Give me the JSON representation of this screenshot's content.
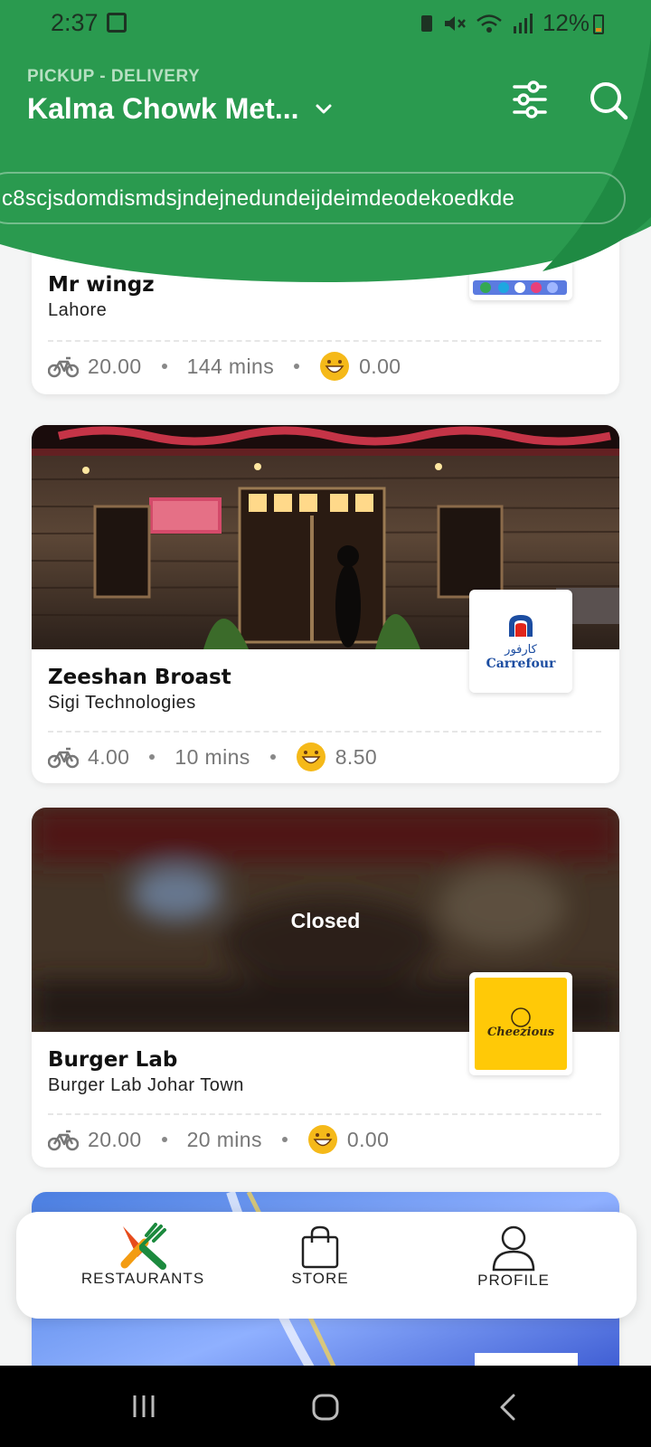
{
  "status_bar": {
    "time": "2:37",
    "battery": "12%"
  },
  "header": {
    "mode_label": "PICKUP - DELIVERY",
    "location": "Kalma Chowk Met...",
    "banner_text": "c8scjsdomdismdsjndejnedundeijdeimdeodekoedkde",
    "colors": {
      "brand_green": "#2a9a4f",
      "wave_dark": "#1f8a43"
    }
  },
  "restaurants": [
    {
      "name": "Mr wingz",
      "branch": "Lahore",
      "delivery_fee": "20.00",
      "time": "144 mins",
      "rating": "0.00",
      "closed": false
    },
    {
      "name": "Zeeshan Broast",
      "branch": "Sigi Technologies",
      "delivery_fee": "4.00",
      "time": "10 mins",
      "rating": "8.50",
      "logo_text": "Carrefour",
      "logo_arabic": "كارفور",
      "closed": false
    },
    {
      "name": "Burger Lab",
      "branch": "Burger Lab Johar Town",
      "delivery_fee": "20.00",
      "time": "20 mins",
      "rating": "0.00",
      "status_label": "Closed",
      "logo_text": "Cheezious",
      "closed": true
    }
  ],
  "bottom_nav": [
    {
      "label": "RESTAURANTS",
      "icon": "restaurants-icon",
      "active": true
    },
    {
      "label": "STORE",
      "icon": "shopping-bag-icon",
      "active": false
    },
    {
      "label": "PROFILE",
      "icon": "profile-icon",
      "active": false
    }
  ]
}
